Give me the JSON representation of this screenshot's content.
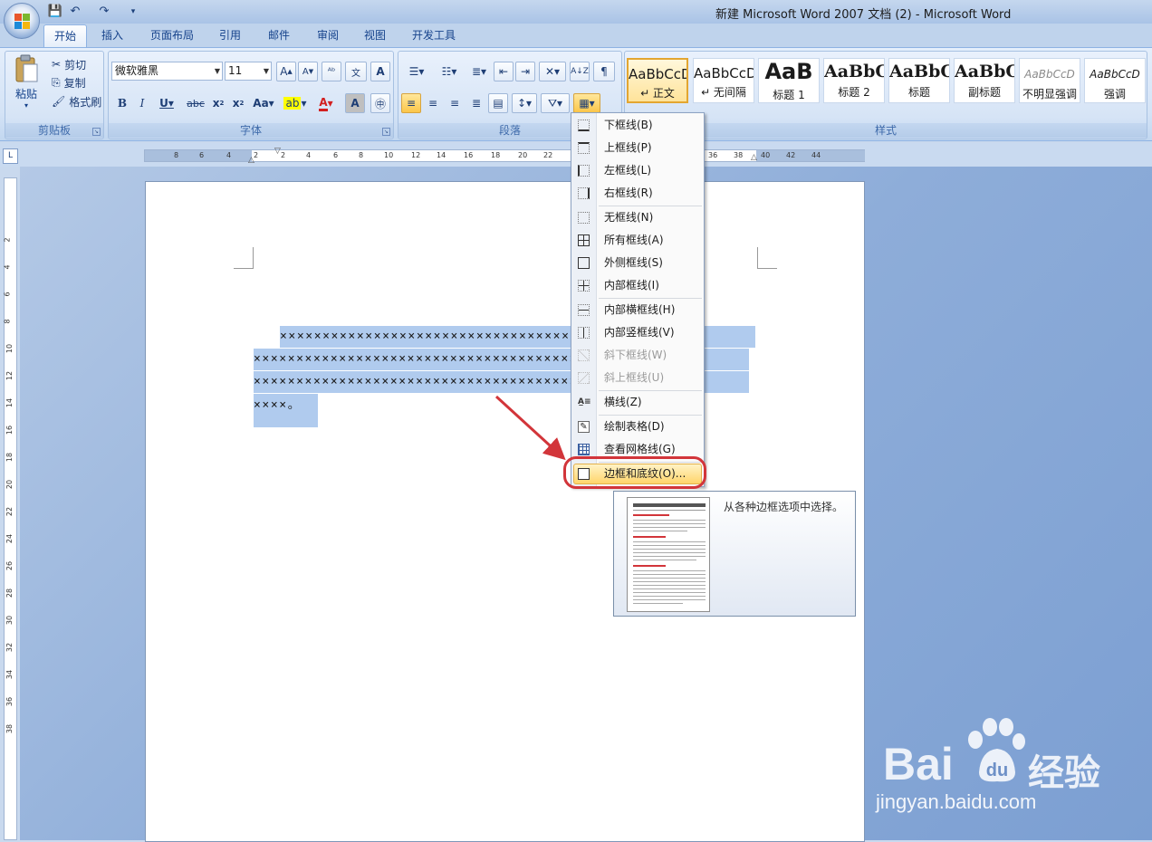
{
  "window": {
    "title": "新建 Microsoft Word 2007 文档 (2) - Microsoft Word"
  },
  "quick_access": [
    {
      "icon": "save-icon"
    },
    {
      "icon": "undo-icon"
    },
    {
      "icon": "redo-icon"
    },
    {
      "icon": "customize-icon"
    }
  ],
  "tabs": [
    "开始",
    "插入",
    "页面布局",
    "引用",
    "邮件",
    "审阅",
    "视图",
    "开发工具"
  ],
  "clipboard": {
    "paste": "粘贴",
    "cut": "剪切",
    "copy": "复制",
    "format_painter": "格式刷",
    "label": "剪贴板"
  },
  "font": {
    "name": "微软雅黑",
    "size": "11",
    "label": "字体"
  },
  "paragraph": {
    "label": "段落"
  },
  "styles": {
    "label": "样式",
    "items": [
      {
        "preview": "AaBbCcD",
        "name": "↵ 正文"
      },
      {
        "preview": "AaBbCcD",
        "name": "↵ 无间隔"
      },
      {
        "preview": "AaB",
        "name": "标题 1"
      },
      {
        "preview": "AaBbC",
        "name": "标题 2"
      },
      {
        "preview": "AaBbC",
        "name": "标题"
      },
      {
        "preview": "AaBbC",
        "name": "副标题"
      },
      {
        "preview": "AaBbCcD",
        "name": "不明显强调"
      },
      {
        "preview": "AaBbCcD",
        "name": "强调"
      }
    ]
  },
  "ruler": {
    "h_numbers": [
      "8",
      "6",
      "4",
      "2",
      "2",
      "4",
      "6",
      "8",
      "10",
      "12",
      "14",
      "16",
      "18",
      "20",
      "22",
      "36",
      "38",
      "40",
      "42",
      "44"
    ],
    "v_numbers": [
      "2",
      "4",
      "6",
      "8",
      "10",
      "12",
      "14",
      "16",
      "18",
      "20",
      "22",
      "24",
      "26",
      "28",
      "30",
      "32",
      "34",
      "36",
      "38"
    ]
  },
  "document": {
    "lines": [
      "××××××××××××××××××××××××××××××××××××××××××××××××",
      "××××××××××××××××××××××××××××××××××××××××××××××××",
      "××××××××××××××××××××××××××××××××××××××××××××××××",
      "××××。"
    ]
  },
  "border_menu": {
    "items": [
      {
        "label": "下框线(B)",
        "icon": "bottom-border-icon",
        "disabled": false
      },
      {
        "label": "上框线(P)",
        "icon": "top-border-icon",
        "disabled": false
      },
      {
        "label": "左框线(L)",
        "icon": "left-border-icon",
        "disabled": false
      },
      {
        "label": "右框线(R)",
        "icon": "right-border-icon",
        "disabled": false
      },
      {
        "label": "无框线(N)",
        "icon": "no-border-icon",
        "disabled": false
      },
      {
        "label": "所有框线(A)",
        "icon": "all-borders-icon",
        "disabled": false
      },
      {
        "label": "外侧框线(S)",
        "icon": "outside-borders-icon",
        "disabled": false
      },
      {
        "label": "内部框线(I)",
        "icon": "inside-borders-icon",
        "disabled": false
      },
      {
        "label": "内部横框线(H)",
        "icon": "inside-horizontal-border-icon",
        "disabled": false
      },
      {
        "label": "内部竖框线(V)",
        "icon": "inside-vertical-border-icon",
        "disabled": false
      },
      {
        "label": "斜下框线(W)",
        "icon": "diagonal-down-border-icon",
        "disabled": true
      },
      {
        "label": "斜上框线(U)",
        "icon": "diagonal-up-border-icon",
        "disabled": true
      },
      {
        "label": "横线(Z)",
        "icon": "horizontal-line-icon",
        "disabled": false
      },
      {
        "label": "绘制表格(D)",
        "icon": "draw-table-icon",
        "disabled": false
      },
      {
        "label": "查看网格线(G)",
        "icon": "view-gridlines-icon",
        "disabled": false
      },
      {
        "label": "边框和底纹(O)...",
        "icon": "borders-shading-icon",
        "disabled": false,
        "highlighted": true
      }
    ]
  },
  "tooltip": {
    "text": "从各种边框选项中选择。"
  },
  "watermark": {
    "brand": "Bai",
    "suffix": "经验",
    "url": "jingyan.baidu.com"
  },
  "colors": {
    "accent": "#d2353a",
    "highlight": "#ffd56b",
    "selection": "#b0cbee"
  }
}
